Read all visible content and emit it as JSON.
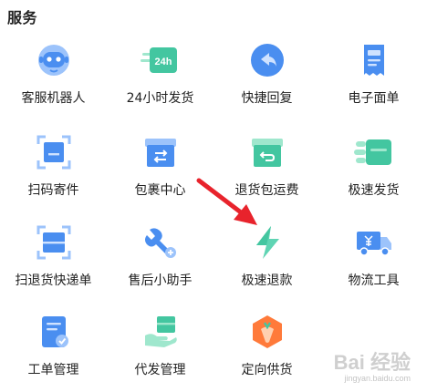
{
  "section": {
    "title": "服务"
  },
  "items": [
    {
      "label": "客服机器人",
      "icon": "robot-icon"
    },
    {
      "label": "24小时发货",
      "icon": "24h-shipping-icon"
    },
    {
      "label": "快捷回复",
      "icon": "quick-reply-icon"
    },
    {
      "label": "电子面单",
      "icon": "e-waybill-icon"
    },
    {
      "label": "扫码寄件",
      "icon": "scan-send-icon"
    },
    {
      "label": "包裹中心",
      "icon": "parcel-center-icon"
    },
    {
      "label": "退货包运费",
      "icon": "return-shipping-icon"
    },
    {
      "label": "极速发货",
      "icon": "fast-shipping-icon"
    },
    {
      "label": "扫退货快递单",
      "icon": "scan-return-icon"
    },
    {
      "label": "售后小助手",
      "icon": "aftersale-helper-icon"
    },
    {
      "label": "极速退款",
      "icon": "fast-refund-icon"
    },
    {
      "label": "物流工具",
      "icon": "logistics-truck-icon"
    },
    {
      "label": "工单管理",
      "icon": "work-order-icon"
    },
    {
      "label": "代发管理",
      "icon": "dropship-icon"
    },
    {
      "label": "定向供货",
      "icon": "directed-supply-icon"
    }
  ],
  "icon_text": {
    "badge_24h": "24h"
  },
  "colors": {
    "blue": "#4a8ef0",
    "blue_light": "#9cc3fb",
    "green": "#43c6a0",
    "green_light": "#9fe7cd",
    "orange": "#ff7a3a",
    "arrow_red": "#e8232c"
  },
  "watermark": {
    "logo": "Bai 经验",
    "url": "jingyan.baidu.com"
  }
}
